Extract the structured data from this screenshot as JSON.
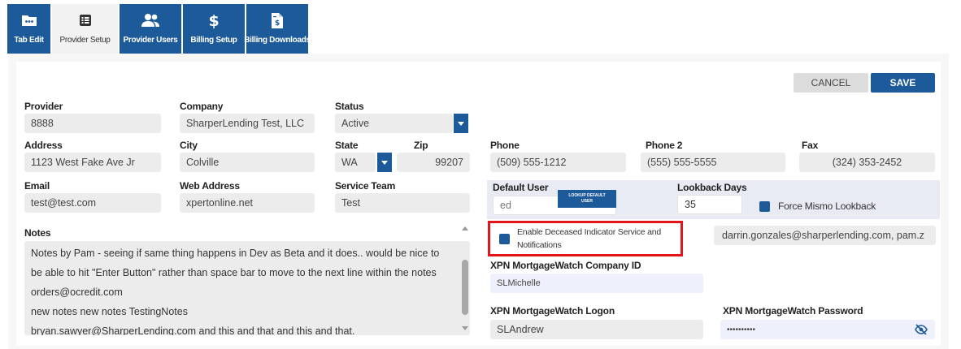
{
  "tabs": [
    {
      "label": "Tab Edit",
      "icon": "ellipsis-folder-icon"
    },
    {
      "label": "Provider Setup",
      "icon": "list-icon"
    },
    {
      "label": "Provider Users",
      "icon": "users-icon"
    },
    {
      "label": "Billing Setup",
      "icon": "dollar-icon"
    },
    {
      "label": "Billing Downloads",
      "icon": "invoice-icon"
    }
  ],
  "actions": {
    "cancel": "CANCEL",
    "save": "SAVE"
  },
  "fields": {
    "provider": {
      "label": "Provider",
      "value": "8888"
    },
    "company": {
      "label": "Company",
      "value": "SharperLending Test, LLC"
    },
    "status": {
      "label": "Status",
      "value": "Active"
    },
    "address": {
      "label": "Address",
      "value": "1123 West Fake Ave Jr"
    },
    "city": {
      "label": "City",
      "value": "Colville"
    },
    "state": {
      "label": "State",
      "value": "WA"
    },
    "zip": {
      "label": "Zip",
      "value": "99207"
    },
    "phone": {
      "label": "Phone",
      "value": "(509) 555-1212"
    },
    "phone2": {
      "label": "Phone 2",
      "value": "(555) 555-5555"
    },
    "fax": {
      "label": "Fax",
      "value": "(324) 353-2452"
    },
    "email": {
      "label": "Email",
      "value": "test@test.com"
    },
    "web": {
      "label": "Web Address",
      "value": "xpertonline.net"
    },
    "service_team": {
      "label": "Service Team",
      "value": "Test"
    },
    "default_user": {
      "label": "Default User",
      "value": "ed",
      "lookup_line1": "LOOKUP DEFAULT",
      "lookup_line2": "USER"
    },
    "lookback": {
      "label": "Lookback Days",
      "value": "35"
    },
    "force_mismo": {
      "label": "Force Mismo Lookback"
    },
    "deceased": {
      "label_line1": "Enable Deceased Indicator Service and",
      "label_line2": "Notifications"
    },
    "notify_emails": {
      "value": "darrin.gonzales@sharperlending.com, pam.z"
    },
    "company_id": {
      "label": "XPN MortgageWatch Company ID",
      "value": "SLMichelle"
    },
    "logon": {
      "label": "XPN MortgageWatch Logon",
      "value": "SLAndrew"
    },
    "password": {
      "label": "XPN MortgageWatch Password",
      "value": "••••••••••"
    }
  },
  "notes": {
    "label": "Notes",
    "lines": [
      "Notes by Pam - seeing if same thing happens in Dev as Beta and it does.. would be nice to",
      "be able to hit \"Enter Button\" rather than space bar to move to the next line within the notes",
      "orders@ocredit.com",
      "new notes new notes TestingNotes",
      "bryan.sawyer@SharperLending.com and this and that and this and that."
    ]
  },
  "colors": {
    "primary": "#1d5a99",
    "highlight": "#e0161b"
  }
}
